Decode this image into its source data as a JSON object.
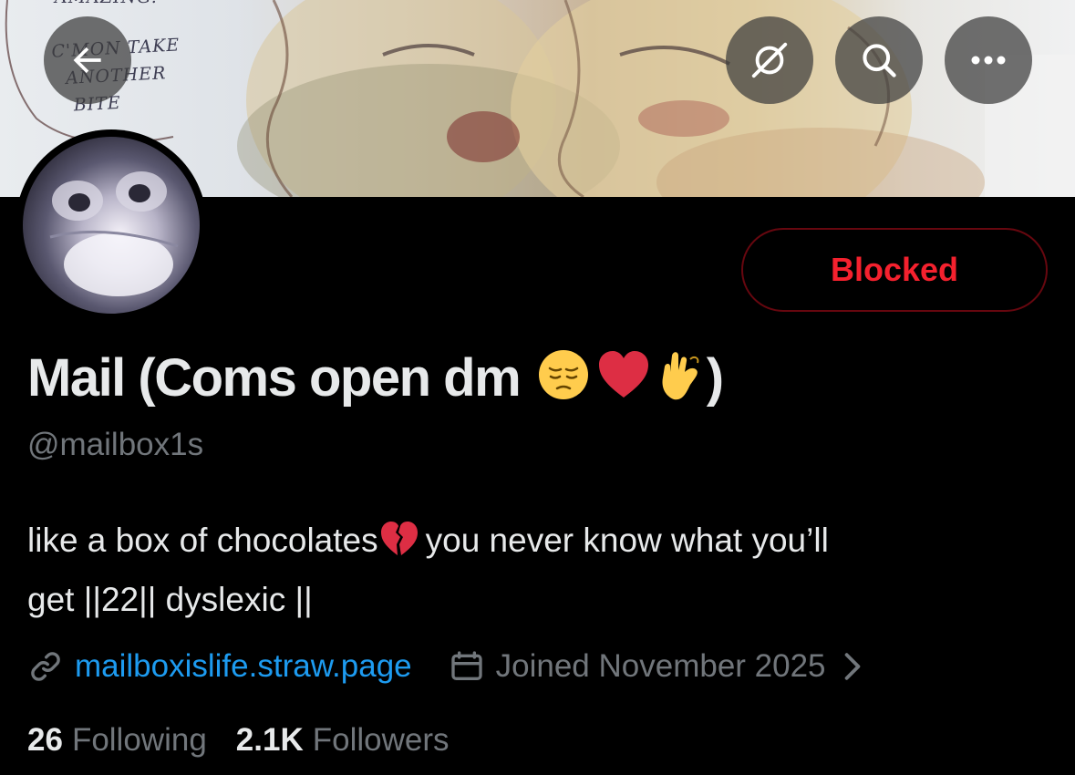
{
  "banner": {
    "note_top": "AMAZING.",
    "note": "C'MON TAKE\n  ANOTHER\n   BITE"
  },
  "header": {
    "back_icon": "arrow-left-icon",
    "grok_icon": "grok-icon",
    "search_icon": "search-icon",
    "more_icon": "more-horizontal-icon"
  },
  "profile": {
    "action_label": "Blocked",
    "display_name_text": "Mail (Coms open dm",
    "display_name_close": ")",
    "handle": "@mailbox1s",
    "bio_line1": "like a box of chocolates",
    "bio_line1_rest": "you never know what you’ll",
    "bio_line2": "get ||22|| dyslexic ||",
    "website": "mailboxislife.straw.page",
    "joined": "Joined November 2025",
    "following_count": "26",
    "following_label": "Following",
    "followers_count": "2.1K",
    "followers_label": "Followers"
  },
  "colors": {
    "blocked_red": "#f4212e",
    "link_blue": "#1d9bf0",
    "muted_gray": "#71767b",
    "text": "#e7e9ea"
  }
}
